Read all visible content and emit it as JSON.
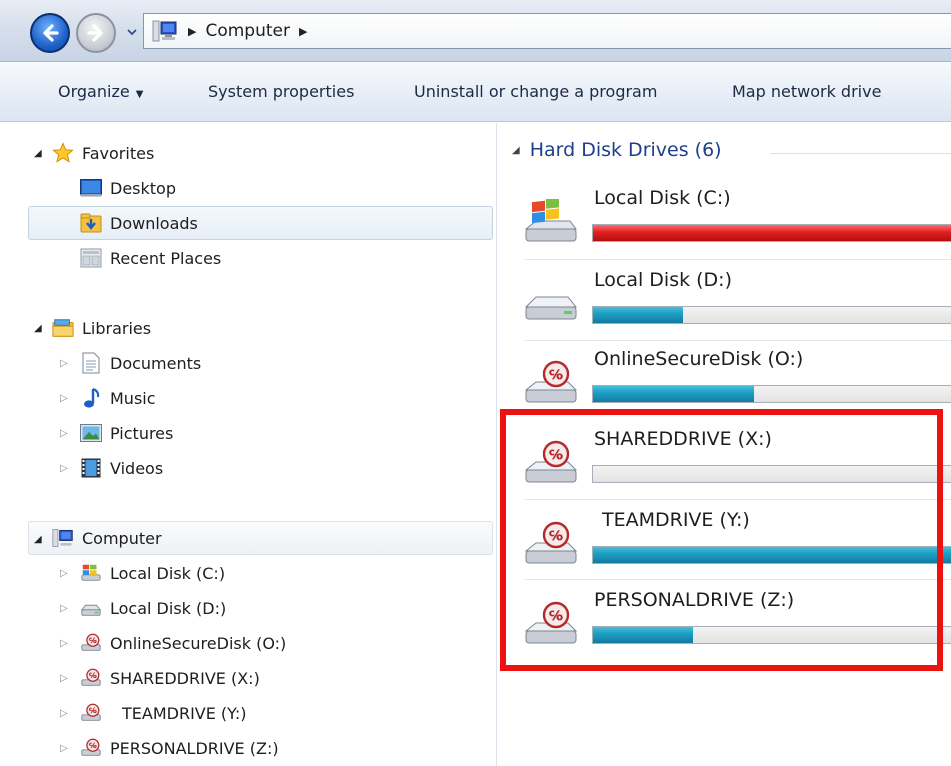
{
  "address_bar": {
    "segments": [
      "Computer"
    ]
  },
  "toolbar": {
    "organize": "Organize",
    "system_properties": "System properties",
    "uninstall": "Uninstall or change a program",
    "map_drive": "Map network drive"
  },
  "nav": {
    "favorites": {
      "label": "Favorites",
      "items": [
        "Desktop",
        "Downloads",
        "Recent Places"
      ]
    },
    "libraries": {
      "label": "Libraries",
      "items": [
        "Documents",
        "Music",
        "Pictures",
        "Videos"
      ]
    },
    "computer": {
      "label": "Computer",
      "items": [
        "Local Disk (C:)",
        "Local Disk (D:)",
        "OnlineSecureDisk (O:)",
        "SHAREDDRIVE (X:)",
        "TEAMDRIVE (Y:)",
        "PERSONALDRIVE (Z:)"
      ]
    }
  },
  "content": {
    "group_title": "Hard Disk Drives (6)",
    "drives": [
      {
        "name": "Local Disk (C:)",
        "icon": "windows-drive-icon",
        "used_fraction": 1.0,
        "color": "#e02020"
      },
      {
        "name": "Local Disk (D:)",
        "icon": "hard-drive-icon",
        "used_fraction": 0.25,
        "color": "#1c9cc2"
      },
      {
        "name": "OnlineSecureDisk (O:)",
        "icon": "secure-drive-icon",
        "used_fraction": 0.45,
        "color": "#1c9cc2"
      },
      {
        "name": "SHAREDDRIVE (X:)",
        "icon": "secure-drive-icon",
        "used_fraction": 0.0,
        "color": "#1c9cc2"
      },
      {
        "name": "TEAMDRIVE (Y:)",
        "icon": "secure-drive-icon",
        "used_fraction": 1.0,
        "color": "#1c9cc2"
      },
      {
        "name": "PERSONALDRIVE (Z:)",
        "icon": "secure-drive-icon",
        "used_fraction": 0.28,
        "color": "#1c9cc2"
      }
    ]
  },
  "colors": {
    "accent_blue": "#1e3f8c",
    "highlight_red": "#ee1111",
    "bar_blue": "#1c9cc2",
    "bar_red": "#e02020"
  }
}
